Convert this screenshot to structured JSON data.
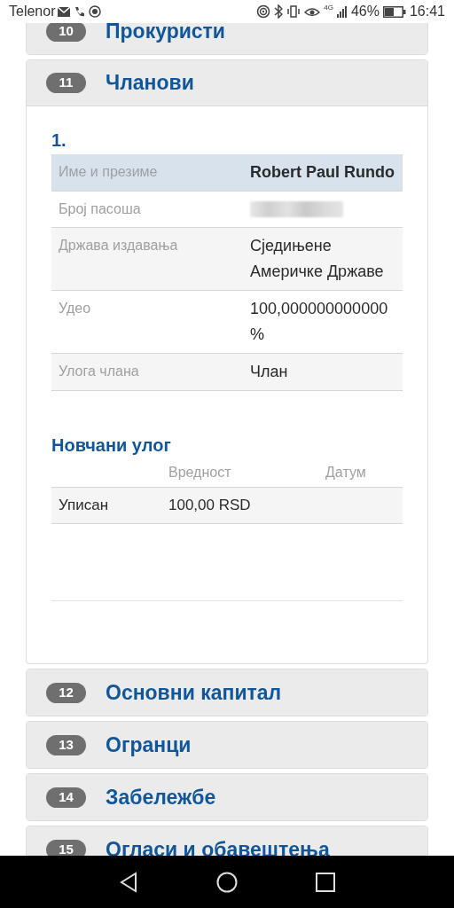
{
  "status_bar": {
    "carrier": "Telenor",
    "network": "4G",
    "battery": "46%",
    "time": "16:41"
  },
  "sections": [
    {
      "number": "10",
      "title": "Прокуристи",
      "expanded": false
    },
    {
      "number": "11",
      "title": "Чланови",
      "expanded": true,
      "members": [
        {
          "index": "1.",
          "rows": [
            {
              "kind": "heading",
              "label": "Име и презиме",
              "value": "Robert Paul Rundo"
            },
            {
              "kind": "redacted",
              "label": "Број пасоша"
            },
            {
              "kind": "field",
              "label": "Држава издавања",
              "value": "Сједињене Америчке Државе"
            },
            {
              "kind": "field",
              "label": "Удео",
              "value": "100,000000000000 %"
            },
            {
              "kind": "field",
              "label": "Улога члана",
              "value": "Члан"
            }
          ]
        }
      ],
      "contribution": {
        "title": "Новчани улог",
        "columns": [
          "Вредност",
          "Датум"
        ],
        "rows": [
          {
            "type": "Уписан",
            "value": "100,00 RSD"
          }
        ]
      }
    },
    {
      "number": "12",
      "title": "Основни капитал",
      "expanded": false
    },
    {
      "number": "13",
      "title": "Огранци",
      "expanded": false
    },
    {
      "number": "14",
      "title": "Забележбе",
      "expanded": false
    },
    {
      "number": "15",
      "title": "Огласи и обавештења",
      "expanded": false
    }
  ]
}
